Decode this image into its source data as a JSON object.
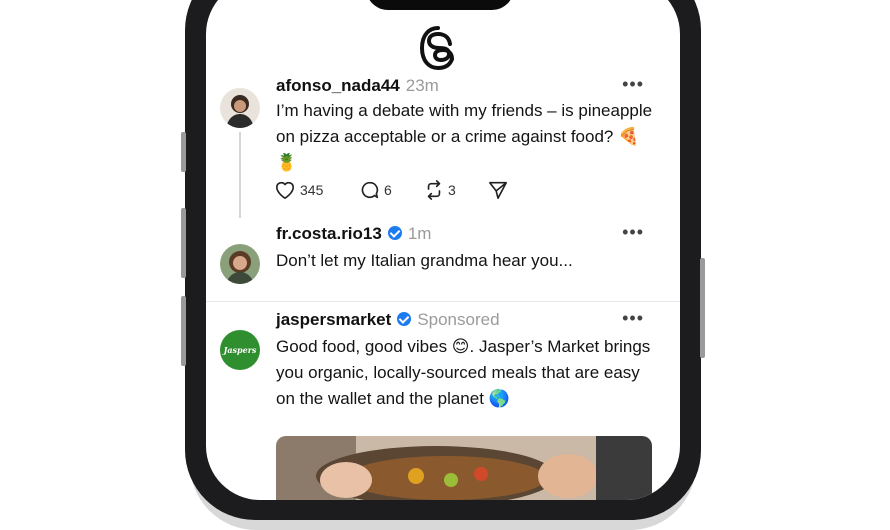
{
  "feed": {
    "posts": [
      {
        "username": "afonso_nada44",
        "time": "23m",
        "text": "I’m having a debate with my friends – is pineapple on pizza acceptable or a crime against food? 🍕🍍",
        "likes": "345",
        "replies": "6",
        "reposts": "3"
      },
      {
        "username": "fr.costa.rio13",
        "time": "1m",
        "text": "Don’t let my Italian grandma hear you..."
      },
      {
        "username": "jaspersmarket",
        "label": "Sponsored",
        "text": "Good food, good vibes 😊. Jasper’s Market brings you organic, locally-sourced meals that are easy on the wallet and the planet 🌎",
        "avatar_text": "Jaspers"
      }
    ],
    "more_label": "•••"
  },
  "icons": {
    "app_logo": "threads-logo-icon",
    "like": "heart-icon",
    "reply": "comment-icon",
    "repost": "repost-icon",
    "share": "send-icon",
    "verified": "verified-badge-icon"
  },
  "colors": {
    "verified": "#1d7bf0",
    "muted": "#9b9b9b",
    "brand_green": "#2f8f2f"
  }
}
